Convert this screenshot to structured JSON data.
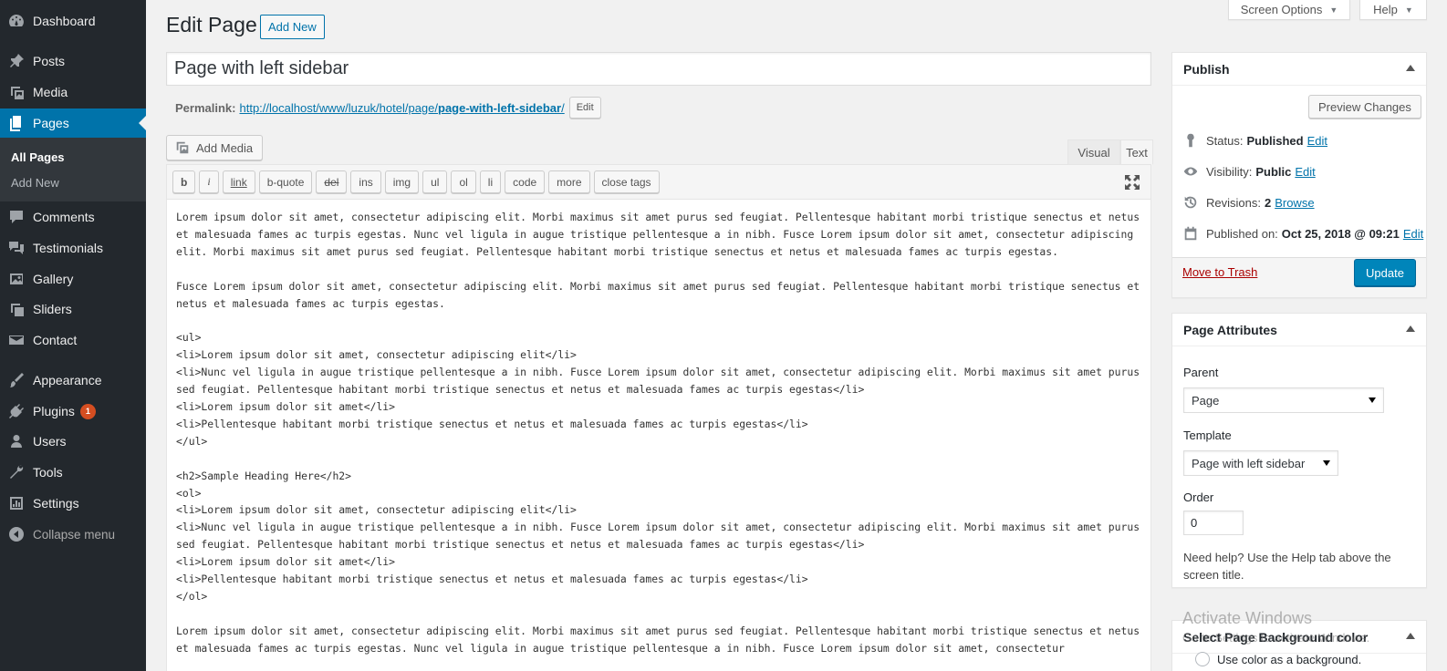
{
  "sidebar": {
    "items": [
      {
        "label": "Dashboard",
        "icon": "dashboard-icon"
      },
      {
        "label": "Posts",
        "icon": "pin-icon"
      },
      {
        "label": "Media",
        "icon": "media-icon"
      },
      {
        "label": "Pages",
        "icon": "pages-icon"
      },
      {
        "label": "Comments",
        "icon": "comments-icon"
      },
      {
        "label": "Testimonials",
        "icon": "testimonials-icon"
      },
      {
        "label": "Gallery",
        "icon": "gallery-icon"
      },
      {
        "label": "Sliders",
        "icon": "sliders-icon"
      },
      {
        "label": "Contact",
        "icon": "mail-icon"
      },
      {
        "label": "Appearance",
        "icon": "brush-icon"
      },
      {
        "label": "Plugins",
        "icon": "plugin-icon",
        "badge": "1"
      },
      {
        "label": "Users",
        "icon": "users-icon"
      },
      {
        "label": "Tools",
        "icon": "wrench-icon"
      },
      {
        "label": "Settings",
        "icon": "settings-icon"
      }
    ],
    "submenu": [
      "All Pages",
      "Add New"
    ],
    "collapse_label": "Collapse menu"
  },
  "top_tabs": {
    "screen_options": "Screen Options",
    "help": "Help"
  },
  "header": {
    "title": "Edit Page",
    "add_new": "Add New"
  },
  "post_title": "Page with left sidebar",
  "permalink": {
    "label": "Permalink:",
    "url_base": "http://localhost/www/luzuk/hotel/page/",
    "slug": "page-with-left-sidebar",
    "url_trail": "/",
    "edit": "Edit"
  },
  "editor": {
    "add_media": "Add Media",
    "tab_visual": "Visual",
    "tab_text": "Text",
    "quicktags": [
      "b",
      "i",
      "link",
      "b-quote",
      "del",
      "ins",
      "img",
      "ul",
      "ol",
      "li",
      "code",
      "more",
      "close tags"
    ],
    "content": "Lorem ipsum dolor sit amet, consectetur adipiscing elit. Morbi maximus sit amet purus sed feugiat. Pellentesque habitant morbi tristique senectus et netus et malesuada fames ac turpis egestas. Nunc vel ligula in augue tristique pellentesque a in nibh. Fusce Lorem ipsum dolor sit amet, consectetur adipiscing elit. Morbi maximus sit amet purus sed feugiat. Pellentesque habitant morbi tristique senectus et netus et malesuada fames ac turpis egestas.\n\nFusce Lorem ipsum dolor sit amet, consectetur adipiscing elit. Morbi maximus sit amet purus sed feugiat. Pellentesque habitant morbi tristique senectus et netus et malesuada fames ac turpis egestas.\n\n<ul>\n<li>Lorem ipsum dolor sit amet, consectetur adipiscing elit</li>\n<li>Nunc vel ligula in augue tristique pellentesque a in nibh. Fusce Lorem ipsum dolor sit amet, consectetur adipiscing elit. Morbi maximus sit amet purus sed feugiat. Pellentesque habitant morbi tristique senectus et netus et malesuada fames ac turpis egestas</li>\n<li>Lorem ipsum dolor sit amet</li>\n<li>Pellentesque habitant morbi tristique senectus et netus et malesuada fames ac turpis egestas</li>\n</ul>\n\n<h2>Sample Heading Here</h2>\n<ol>\n<li>Lorem ipsum dolor sit amet, consectetur adipiscing elit</li>\n<li>Nunc vel ligula in augue tristique pellentesque a in nibh. Fusce Lorem ipsum dolor sit amet, consectetur adipiscing elit. Morbi maximus sit amet purus sed feugiat. Pellentesque habitant morbi tristique senectus et netus et malesuada fames ac turpis egestas</li>\n<li>Lorem ipsum dolor sit amet</li>\n<li>Pellentesque habitant morbi tristique senectus et netus et malesuada fames ac turpis egestas</li>\n</ol>\n\nLorem ipsum dolor sit amet, consectetur adipiscing elit. Morbi maximus sit amet purus sed feugiat. Pellentesque habitant morbi tristique senectus et netus et malesuada fames ac turpis egestas. Nunc vel ligula in augue tristique pellentesque a in nibh. Fusce Lorem ipsum dolor sit amet, consectetur"
  },
  "publish": {
    "title": "Publish",
    "preview": "Preview Changes",
    "status_label": "Status:",
    "status_value": "Published",
    "visibility_label": "Visibility:",
    "visibility_value": "Public",
    "revisions_label": "Revisions:",
    "revisions_value": "2",
    "browse": "Browse",
    "published_label": "Published on:",
    "published_value": "Oct 25, 2018 @ 09:21",
    "edit": "Edit",
    "trash": "Move to Trash",
    "update": "Update"
  },
  "attributes": {
    "title": "Page Attributes",
    "parent_label": "Parent",
    "parent_value": "Page",
    "template_label": "Template",
    "template_value": "Page with left sidebar",
    "order_label": "Order",
    "order_value": "0",
    "help": "Need help? Use the Help tab above the screen title."
  },
  "bg_color": {
    "title": "Select Page Background color",
    "radio_label": "Use color as a background."
  },
  "watermark": {
    "title": "Activate Windows",
    "sub": "Go to Settings to activate Windows."
  },
  "colors": {
    "admin_bar": "#23282d",
    "accent": "#0073aa",
    "primary_button": "#0085ba",
    "badge": "#d54e21"
  }
}
